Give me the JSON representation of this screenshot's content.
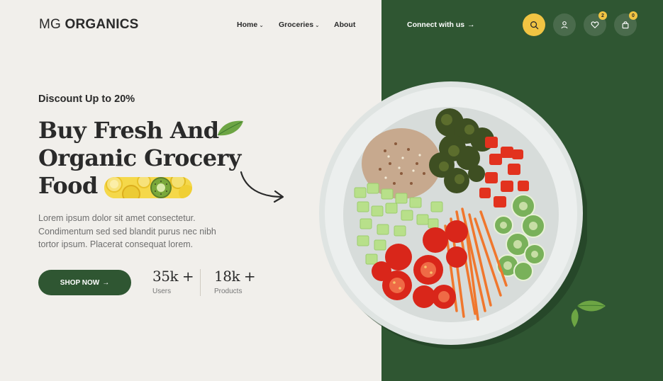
{
  "header": {
    "logo_light": "MG ",
    "logo_bold": "ORGANICS",
    "nav": [
      {
        "label": "Home",
        "dropdown": true
      },
      {
        "label": "Groceries",
        "dropdown": true
      },
      {
        "label": "About",
        "dropdown": false
      }
    ],
    "connect_label": "Connect with us",
    "icons": [
      "search-icon",
      "user-icon",
      "heart-icon",
      "bag-icon"
    ],
    "wishlist_count": "2",
    "cart_count": "0"
  },
  "hero": {
    "discount": "Discount Up to 20%",
    "headline": [
      "Buy Fresh And",
      "Organic Grocery",
      "Food"
    ],
    "description": [
      "Lorem ipsum dolor sit amet consectetur.",
      "Condimentum sed sed blandit purus nec nibh",
      "tortor ipsum. Placerat consequat lorem."
    ],
    "cta_label": "SHOP NOW",
    "stats": [
      {
        "value": "35k +",
        "label": "Users"
      },
      {
        "value": "18k +",
        "label": "Products"
      }
    ]
  },
  "colors": {
    "background": "#f1efeb",
    "brand_green": "#2f5632",
    "accent_yellow": "#f1c443",
    "text_dark": "#2a2a2a",
    "text_muted": "#6e6e6e"
  }
}
